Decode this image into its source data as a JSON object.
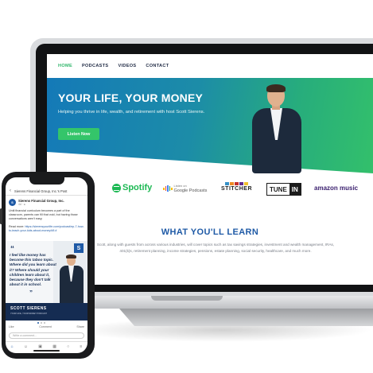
{
  "website": {
    "nav": [
      "HOME",
      "PODCASTS",
      "VIDEOS",
      "CONTACT"
    ],
    "hero_title": "YOUR LIFE, YOUR MONEY",
    "hero_subtitle": "Helping you thrive in life, wealth, and retirement with host Scott Sierens.",
    "hero_button": "Listen Now",
    "logos": {
      "apple": "casts",
      "spotify": "Spotify",
      "google_small": "Listen on",
      "google": "Google Podcasts",
      "stitcher": "STITCHER",
      "tunein_left": "TUNE",
      "tunein_right": "IN",
      "amazon": "amazon music"
    },
    "learn_title": "WHAT YOU'LL LEARN",
    "learn_body": "Scott, along with guests from across various industries, will cover topics such as tax savings strategies, investment and wealth management, IRAs, 401(k)s, retirement planning, income strategies, pensions, estate planning, social security, healthcare, and much more."
  },
  "phone": {
    "header": "Sierens Financial Group, Inc.'s Post",
    "page_name": "Sierens Financial Group, Inc.",
    "avatar_letter": "S",
    "post_time": "4d · ●",
    "post_text": "Until financial curriculum becomes a part of the classroom, parents can fill that void, but having those conversations aren't easy.",
    "read_more_label": "Read more:",
    "read_more_link": "https://sierensyourlife.com/podcast/ep-7-how-to-teach-your-kids-about-money/#8 #",
    "quote_open": "“",
    "quote": "I feel like money has become this taboo topic. Where did you learn about it? Where should your children learn about it, because they don't talk about it in school.",
    "quote_close": "”",
    "badge": "S",
    "speaker_name": "SCOTT SIERENS",
    "speaker_role": "YOUR LIFE, YOUR MONEY PODCAST",
    "actions": [
      "Like",
      "Comment",
      "Share"
    ],
    "comment_placeholder": "Write a comment...",
    "tabbar": [
      "⌂",
      "☺",
      "▣",
      "▦",
      "○",
      "≡"
    ]
  }
}
